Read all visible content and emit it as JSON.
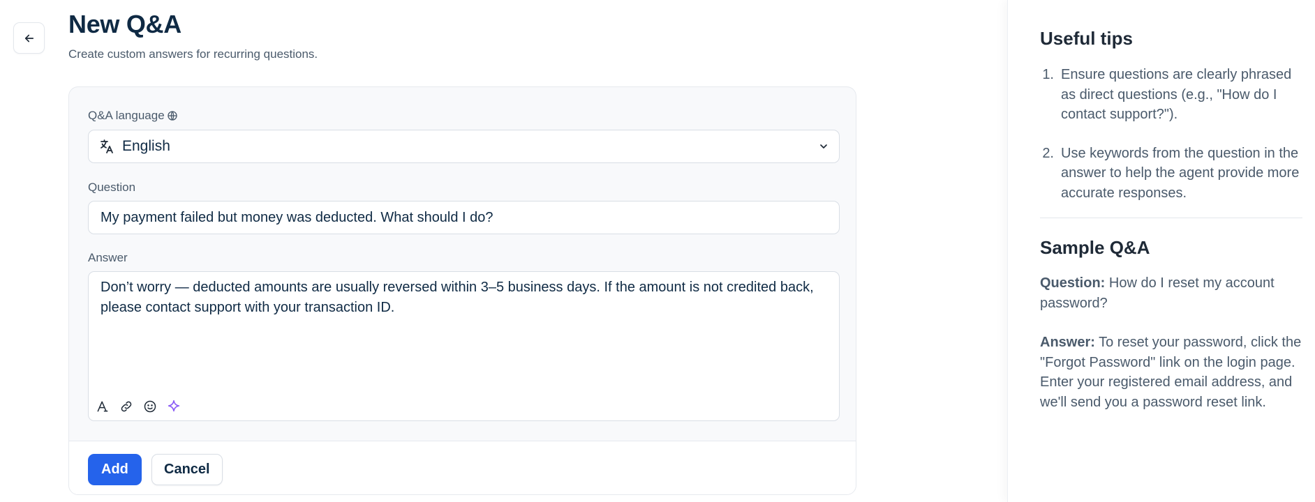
{
  "header": {
    "title": "New Q&A",
    "subtitle": "Create custom answers for recurring questions."
  },
  "icons": {
    "back": "arrow-left-icon",
    "globe": "globe-icon",
    "translate": "translate-icon",
    "chevron": "chevron-down-icon",
    "format": "text-format-icon",
    "link": "link-icon",
    "emoji": "emoji-icon",
    "ai": "sparkle-icon"
  },
  "form": {
    "language_label": "Q&A language",
    "language_value": "English",
    "question_label": "Question",
    "question_value": "My payment failed but money was deducted. What should I do?",
    "answer_label": "Answer",
    "answer_value": "Don’t worry — deducted amounts are usually reversed within 3–5 business days. If the amount is not credited back, please contact support with your transaction ID.",
    "add_label": "Add",
    "cancel_label": "Cancel"
  },
  "tips": {
    "title": "Useful tips",
    "items": [
      {
        "num": "1.",
        "text": "Ensure questions are clearly phrased as direct questions (e.g., \"How do I contact support?\")."
      },
      {
        "num": "2.",
        "text": "Use keywords from the question in the answer to help the agent provide more accurate responses."
      }
    ],
    "sample_title": "Sample Q&A",
    "sample_question_label": "Question:",
    "sample_question_text": " How do I reset my account password?",
    "sample_answer_label": "Answer:",
    "sample_answer_text": " To reset your password, click the \"Forgot Password\" link on the login page. Enter your registered email address, and we'll send you a password reset link."
  },
  "colors": {
    "primary": "#2563eb",
    "heading": "#0f2a44",
    "muted": "#4a5a6b",
    "ai_accent": "#8b5cf6"
  }
}
